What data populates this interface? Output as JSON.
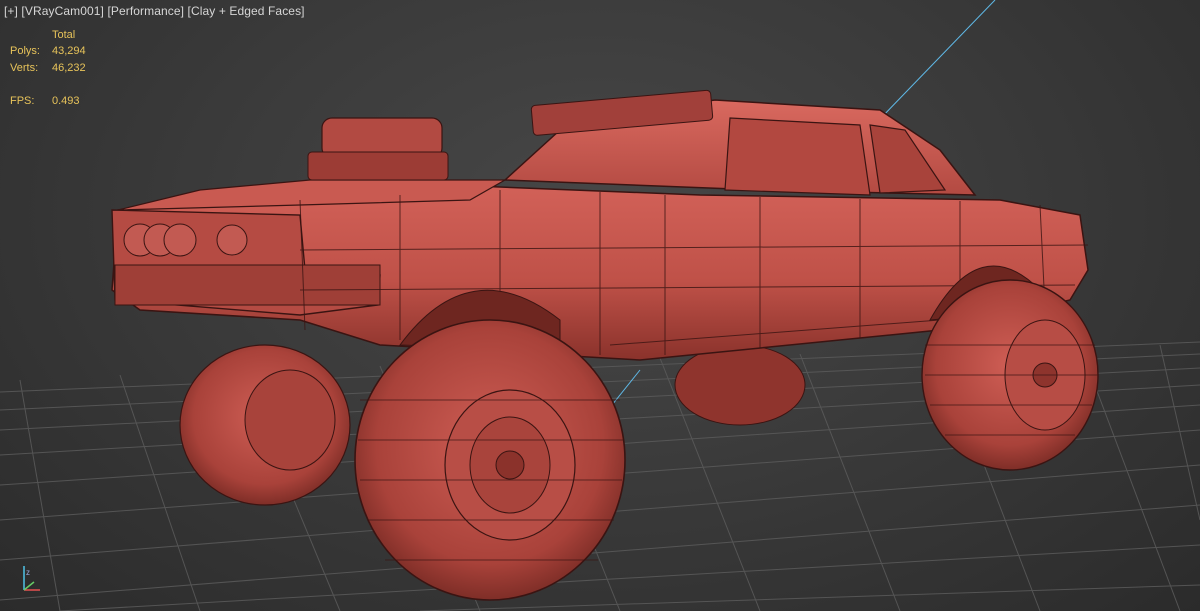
{
  "viewport": {
    "label_menus": [
      "[+]",
      "[VRayCam001]",
      "[Performance]",
      "[Clay + Edged Faces]"
    ]
  },
  "stats": {
    "header": "Total",
    "polys_label": "Polys:",
    "polys_value": "43,294",
    "verts_label": "Verts:",
    "verts_value": "46,232",
    "fps_label": "FPS:",
    "fps_value": "0.493"
  },
  "colors": {
    "stats_text": "#e7c35a",
    "label_text": "#d6d6d6",
    "clay_body": "#c9564d",
    "clay_shadow": "#7d2c26",
    "wire": "#3a1412",
    "grid": "#5a5a5a",
    "camera_line": "#5fb8e6"
  },
  "icons": {
    "axis_tripod": "axis-tripod-icon"
  }
}
